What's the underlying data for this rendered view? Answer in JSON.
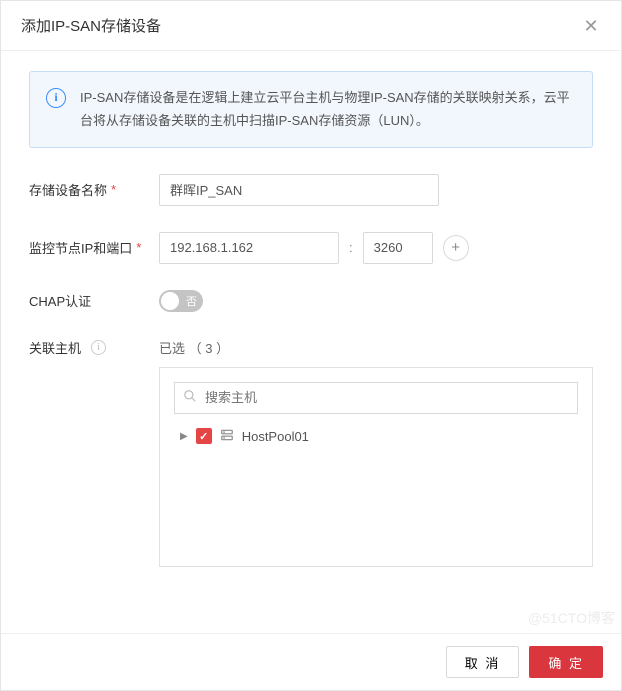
{
  "header": {
    "title": "添加IP-SAN存储设备"
  },
  "info": {
    "text": "IP-SAN存储设备是在逻辑上建立云平台主机与物理IP-SAN存储的关联映射关系，云平台将从存储设备关联的主机中扫描IP-SAN存储资源（LUN）。"
  },
  "form": {
    "name_label": "存储设备名称",
    "name_value": "群晖IP_SAN",
    "monitor_label": "监控节点IP和端口",
    "monitor_ip": "192.168.1.162",
    "monitor_port": "3260",
    "chap_label": "CHAP认证",
    "chap_state_text": "否",
    "hosts_label": "关联主机",
    "hosts_selected_prefix": "已选",
    "hosts_selected_count": "（ 3 ）",
    "search_placeholder": "搜索主机",
    "tree_item_label": "HostPool01"
  },
  "footer": {
    "cancel": "取 消",
    "ok": "确 定"
  },
  "watermark": "@51CTO博客"
}
